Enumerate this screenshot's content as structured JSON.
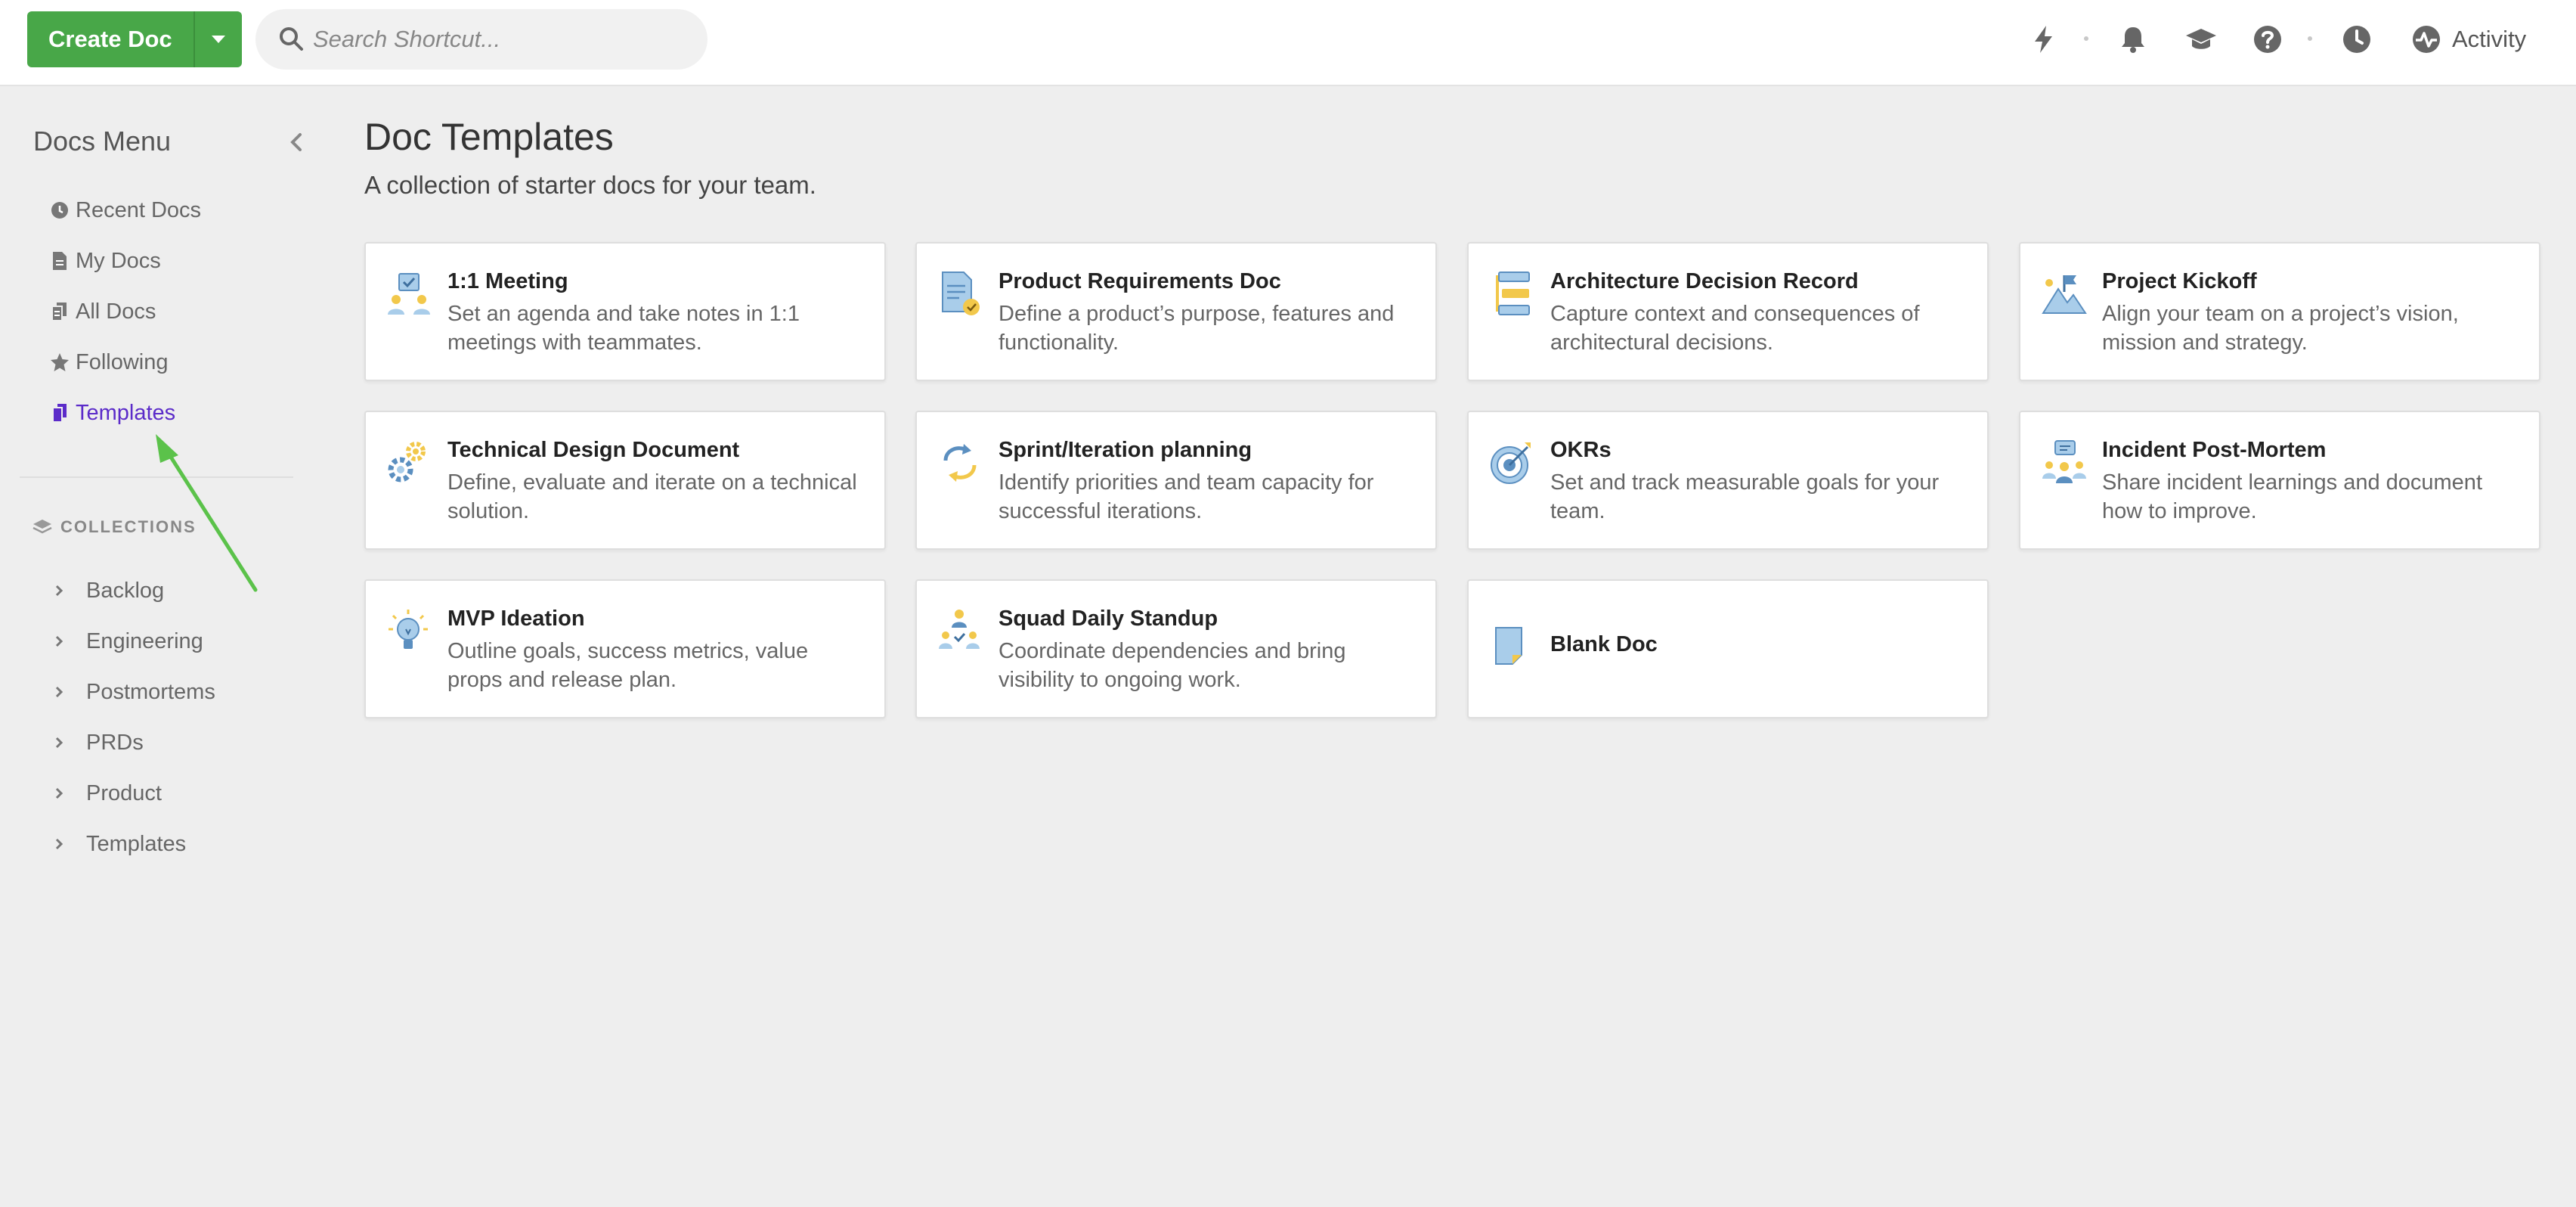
{
  "topbar": {
    "create_label": "Create Doc",
    "search_placeholder": "Search Shortcut...",
    "activity_label": "Activity",
    "icons": [
      "lightning-icon",
      "bell-icon",
      "graduation-cap-icon",
      "help-icon",
      "clock-icon",
      "activity-icon"
    ]
  },
  "sidebar": {
    "title": "Docs Menu",
    "nav": [
      {
        "label": "Recent Docs",
        "icon": "clock-icon"
      },
      {
        "label": "My Docs",
        "icon": "document-icon"
      },
      {
        "label": "All Docs",
        "icon": "documents-icon"
      },
      {
        "label": "Following",
        "icon": "star-icon"
      },
      {
        "label": "Templates",
        "icon": "templates-icon",
        "active": true
      }
    ],
    "collections_header": "COLLECTIONS",
    "collections": [
      "Backlog",
      "Engineering",
      "Postmortems",
      "PRDs",
      "Product",
      "Templates"
    ]
  },
  "main": {
    "title": "Doc Templates",
    "subtitle": "A collection of starter docs for your team.",
    "templates": [
      {
        "title": "1:1 Meeting",
        "desc": "Set an agenda and take notes in 1:1 meetings with teammates.",
        "icon": "meeting-icon"
      },
      {
        "title": "Product Requirements Doc",
        "desc": "Define a product’s purpose, features and functionality.",
        "icon": "requirements-doc-icon"
      },
      {
        "title": "Architecture Decision Record",
        "desc": "Capture context and consequences of architectural decisions.",
        "icon": "architecture-icon"
      },
      {
        "title": "Project Kickoff",
        "desc": "Align your team on a project’s vision, mission and strategy.",
        "icon": "mountain-flag-icon"
      },
      {
        "title": "Technical Design Document",
        "desc": "Define, evaluate and iterate on a technical solution.",
        "icon": "gears-icon"
      },
      {
        "title": "Sprint/Iteration planning",
        "desc": "Identify priorities and team capacity for successful iterations.",
        "icon": "cycle-icon"
      },
      {
        "title": "OKRs",
        "desc": "Set and track measurable goals for your team.",
        "icon": "target-icon"
      },
      {
        "title": "Incident Post-Mortem",
        "desc": "Share incident learnings and document how to improve.",
        "icon": "team-discussion-icon"
      },
      {
        "title": "MVP Ideation",
        "desc": "Outline goals, success metrics, value props and release plan.",
        "icon": "lightbulb-icon"
      },
      {
        "title": "Squad Daily Standup",
        "desc": "Coordinate dependencies and bring visibility to ongoing work.",
        "icon": "squad-icon"
      },
      {
        "title": "Blank Doc",
        "desc": "",
        "icon": "blank-doc-icon"
      }
    ]
  },
  "colors": {
    "accent_green": "#48a748",
    "active_purple": "#5b2bc9",
    "annotation_arrow": "#5bc24a",
    "icon_blue": "#7fb3d9",
    "icon_yellow": "#f2c84b"
  }
}
